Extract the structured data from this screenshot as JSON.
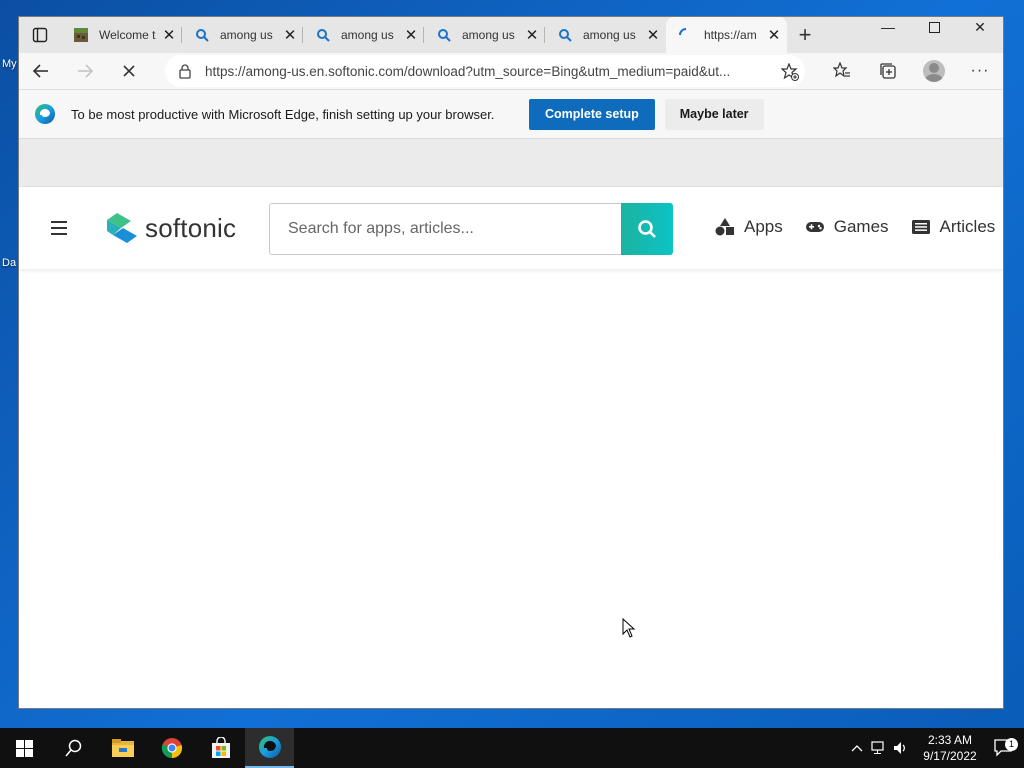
{
  "desktop": {
    "label_top": "My",
    "label_bottom": "Da"
  },
  "browser": {
    "tabs": [
      {
        "title": "Welcome t",
        "icon": "minecraft-icon"
      },
      {
        "title": "among us",
        "icon": "search-icon"
      },
      {
        "title": "among us",
        "icon": "search-icon"
      },
      {
        "title": "among us",
        "icon": "search-icon"
      },
      {
        "title": "among us",
        "icon": "search-icon"
      },
      {
        "title": "https://am",
        "icon": "loading-icon",
        "active": true
      }
    ],
    "new_tab_label": "+",
    "url": "https://among-us.en.softonic.com/download?utm_source=Bing&utm_medium=paid&ut...",
    "infobar": {
      "message": "To be most productive with Microsoft Edge, finish setting up your browser.",
      "primary_label": "Complete setup",
      "secondary_label": "Maybe later"
    }
  },
  "site": {
    "logo_text": "softonic",
    "search_placeholder": "Search for apps, articles...",
    "nav": [
      {
        "label": "Apps",
        "icon": "apps-icon"
      },
      {
        "label": "Games",
        "icon": "gamepad-icon"
      },
      {
        "label": "Articles",
        "icon": "articles-icon"
      }
    ],
    "colors": {
      "accent": "#12b8b0",
      "primary_button": "#0f6cbd"
    }
  },
  "taskbar": {
    "time": "2:33 AM",
    "date": "9/17/2022",
    "notification_count": "1"
  }
}
